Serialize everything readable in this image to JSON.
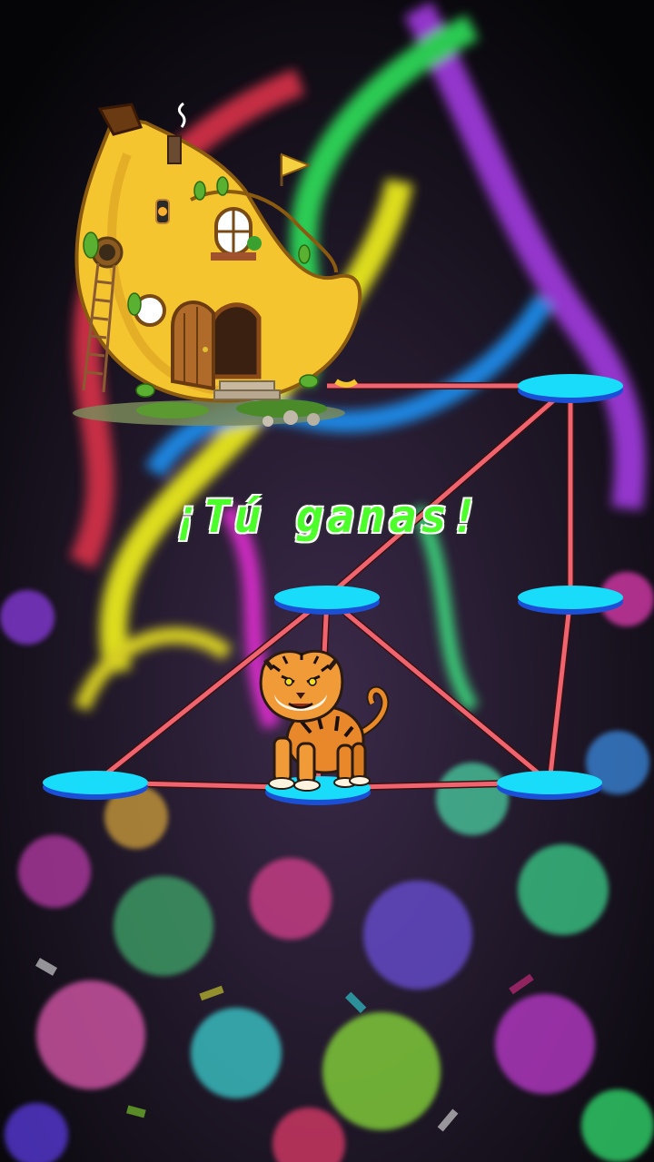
{
  "game": {
    "result_text": "¡Tú ganas!",
    "goal_icon": "banana-house-icon",
    "player_icon": "tiger-icon",
    "background": "colorful-paint-splash-background"
  },
  "colors": {
    "node_fill": "#19dcfa",
    "node_edge": "#1b4fd6",
    "path_line": "#f06470",
    "result_text": "#4cff2b",
    "result_outline": "#ffffff"
  },
  "board": {
    "nodes": [
      {
        "id": "goal",
        "kind": "goal"
      },
      {
        "id": "top-right",
        "kind": "node"
      },
      {
        "id": "middle",
        "kind": "node"
      },
      {
        "id": "mid-right",
        "kind": "node"
      },
      {
        "id": "bottom-left",
        "kind": "node"
      },
      {
        "id": "bottom-center",
        "kind": "node",
        "occupied_by": "tiger"
      },
      {
        "id": "bottom-right",
        "kind": "node"
      }
    ],
    "edges": [
      [
        "goal",
        "top-right"
      ],
      [
        "top-right",
        "middle"
      ],
      [
        "top-right",
        "mid-right"
      ],
      [
        "mid-right",
        "bottom-right"
      ],
      [
        "middle",
        "bottom-left"
      ],
      [
        "middle",
        "bottom-center"
      ],
      [
        "middle",
        "bottom-right"
      ],
      [
        "bottom-left",
        "bottom-center"
      ],
      [
        "bottom-center",
        "bottom-right"
      ]
    ]
  }
}
